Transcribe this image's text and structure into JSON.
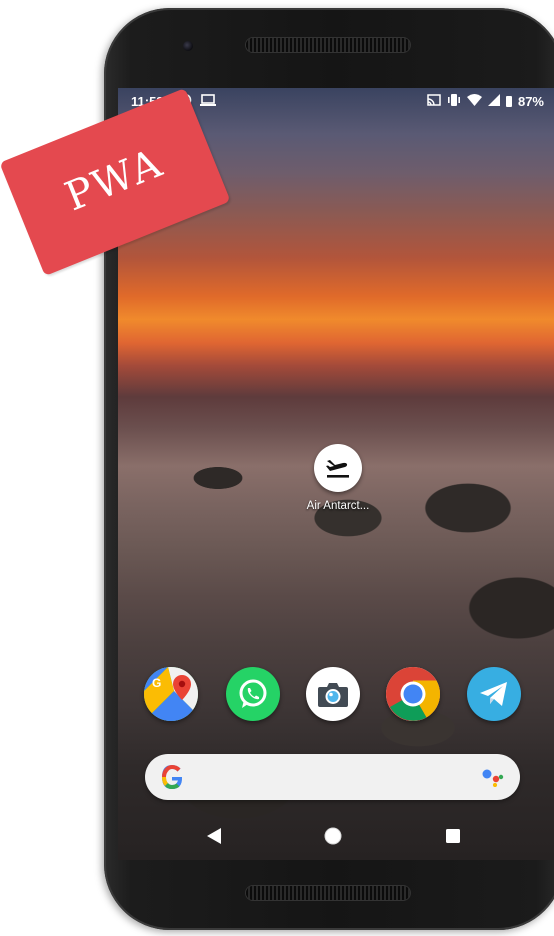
{
  "status_bar": {
    "time": "11:58",
    "battery": "87%",
    "icons": [
      "android-icon",
      "laptop-icon",
      "cast-icon",
      "vibrate-icon",
      "wifi-icon",
      "signal-icon",
      "battery-icon"
    ]
  },
  "home_app": {
    "label": "Air Antarct...",
    "icon": "airplane-landing-icon"
  },
  "dock": [
    {
      "name": "Maps",
      "icon": "google-maps-icon"
    },
    {
      "name": "WhatsApp",
      "icon": "whatsapp-icon"
    },
    {
      "name": "Camera",
      "icon": "camera-icon"
    },
    {
      "name": "Chrome",
      "icon": "chrome-icon"
    },
    {
      "name": "Telegram",
      "icon": "telegram-icon"
    }
  ],
  "search": {
    "logo": "G",
    "assistant_icon": "google-assistant-icon"
  },
  "navigation": {
    "back_icon": "back-triangle-icon",
    "home_icon": "home-circle-icon",
    "recents_icon": "recents-square-icon"
  },
  "tag": {
    "text": "PWA",
    "color": "#e4494f"
  },
  "colors": {
    "telegram": "#37aee2",
    "whatsapp": "#25d366",
    "maps_green": "#34a853",
    "chrome_red": "#db4437",
    "chrome_yellow": "#f4b400",
    "google_blue": "#4285f4"
  }
}
